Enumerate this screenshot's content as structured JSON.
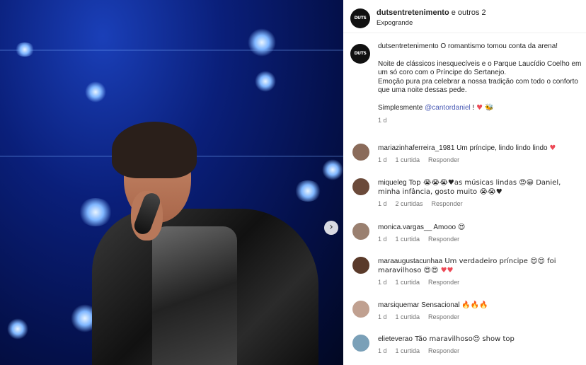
{
  "post_header": {
    "account": "dutsentretenimento",
    "collab_suffix": " e outros 2",
    "location": "Expogrande",
    "avatar_text": "DUTS"
  },
  "photo": {
    "next_glyph": "›"
  },
  "caption": {
    "avatar_text": "DUTS",
    "username": "dutsentretenimento",
    "line1": "O romantismo tomou conta da arena!",
    "line2": "Noite de clássicos inesquecíveis e o Parque Laucídio Coelho em um só coro com o Príncipe do Sertanejo.",
    "line3": "Emoção pura pra celebrar a nossa tradição com todo o conforto que uma noite dessas pede.",
    "line4_prefix": "Simplesmente ",
    "mention": "@cantordaniel",
    "line4_suffix": " ! ",
    "line4_emoji": "♥ 🐝",
    "time": "1 d"
  },
  "comments": [
    {
      "username": "mariazinhaferreira_1981",
      "text": " Um príncipe, lindo lindo lindo ",
      "emoji": "♥",
      "time": "1 d",
      "likes": "1 curtida",
      "reply": "Responder",
      "avatar_color": "#8a6b5a"
    },
    {
      "username": "miqueleg",
      "text": " Top 😭😭😭♥as músicas lindas 😍😀 Daniel, minha infância, gosto muito 😭😭♥",
      "emoji": "",
      "time": "1 d",
      "likes": "2 curtidas",
      "reply": "Responder",
      "avatar_color": "#6b4a3a"
    },
    {
      "username": "monica.vargas__",
      "text": " Amooo ",
      "emoji": "😍",
      "time": "1 d",
      "likes": "1 curtida",
      "reply": "Responder",
      "avatar_color": "#9a8070"
    },
    {
      "username": "maraaugustacunhaa",
      "text": " Um verdadeiro príncipe 😍😍 foi maravilhoso 😍😍 ",
      "emoji": "♥♥",
      "time": "1 d",
      "likes": "1 curtida",
      "reply": "Responder",
      "avatar_color": "#5a3a2a"
    },
    {
      "username": "marsiquemar",
      "text": " Sensacional ",
      "emoji": "🔥🔥🔥",
      "time": "1 d",
      "likes": "1 curtida",
      "reply": "Responder",
      "avatar_color": "#c0a090"
    },
    {
      "username": "elieteverao",
      "text": " Tão maravilhoso😍 show top",
      "emoji": "",
      "time": "1 d",
      "likes": "1 curtida",
      "reply": "Responder",
      "avatar_color": "#7aa0b8"
    }
  ]
}
